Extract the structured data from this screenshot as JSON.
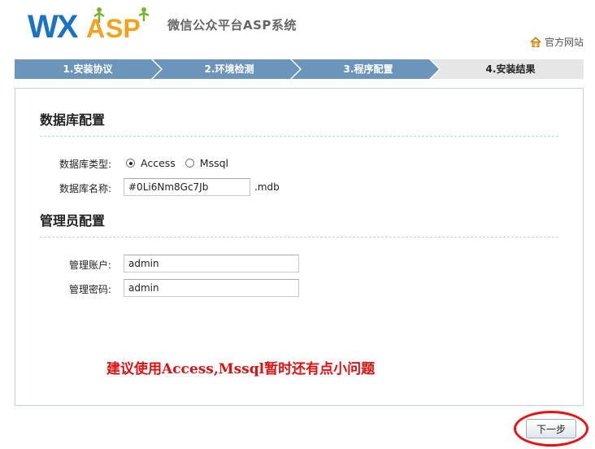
{
  "header": {
    "logo_text": "WXASP",
    "app_title": "微信公众平台ASP系统",
    "home_link": "官方网站"
  },
  "steps": [
    {
      "label": "1.安装协议",
      "state": "done"
    },
    {
      "label": "2.环境检测",
      "state": "done"
    },
    {
      "label": "3.程序配置",
      "state": "done"
    },
    {
      "label": "4.安装结果",
      "state": "current"
    }
  ],
  "colors": {
    "step_done": "#6c95bc",
    "step_current": "#e6e6e6",
    "notice": "#e11010",
    "highlight_ring": "#ee1111"
  },
  "db_section": {
    "title": "数据库配置",
    "type_label": "数据库类型:",
    "type_options": [
      {
        "label": "Access",
        "checked": true
      },
      {
        "label": "Mssql",
        "checked": false
      }
    ],
    "name_label": "数据库名称:",
    "name_value": "#0Li6Nm8Gc7Jb",
    "name_suffix": ".mdb"
  },
  "admin_section": {
    "title": "管理员配置",
    "account_label": "管理账户:",
    "account_value": "admin",
    "password_label": "管理密码:",
    "password_value": "admin"
  },
  "notice": "建议使用Access,Mssql暂时还有点小问题",
  "next_button": "下一步"
}
